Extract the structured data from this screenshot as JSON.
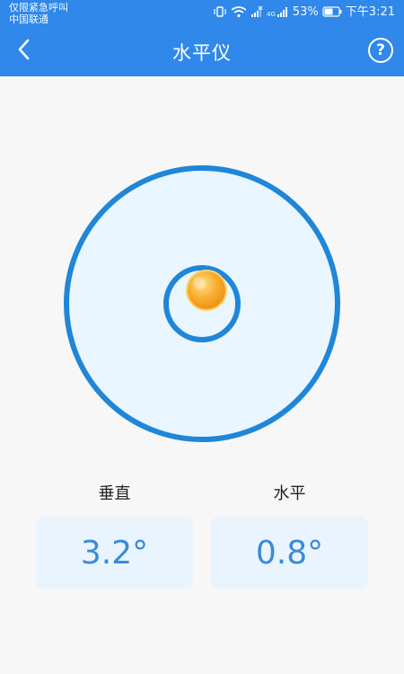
{
  "status": {
    "carrier_line1": "仅限紧急呼叫",
    "carrier_line2": "中国联通",
    "net_label": "4G",
    "battery": "53%",
    "time": "下午3:21"
  },
  "appbar": {
    "title": "水平仪",
    "help": "?"
  },
  "readings": {
    "vertical_label": "垂直",
    "vertical_value": "3.2°",
    "horizontal_label": "水平",
    "horizontal_value": "0.8°"
  },
  "colors": {
    "accent": "#2f88ea",
    "ring": "#1f86d8",
    "disc_fill": "#eaf6ff",
    "bubble": "#f7a928"
  }
}
